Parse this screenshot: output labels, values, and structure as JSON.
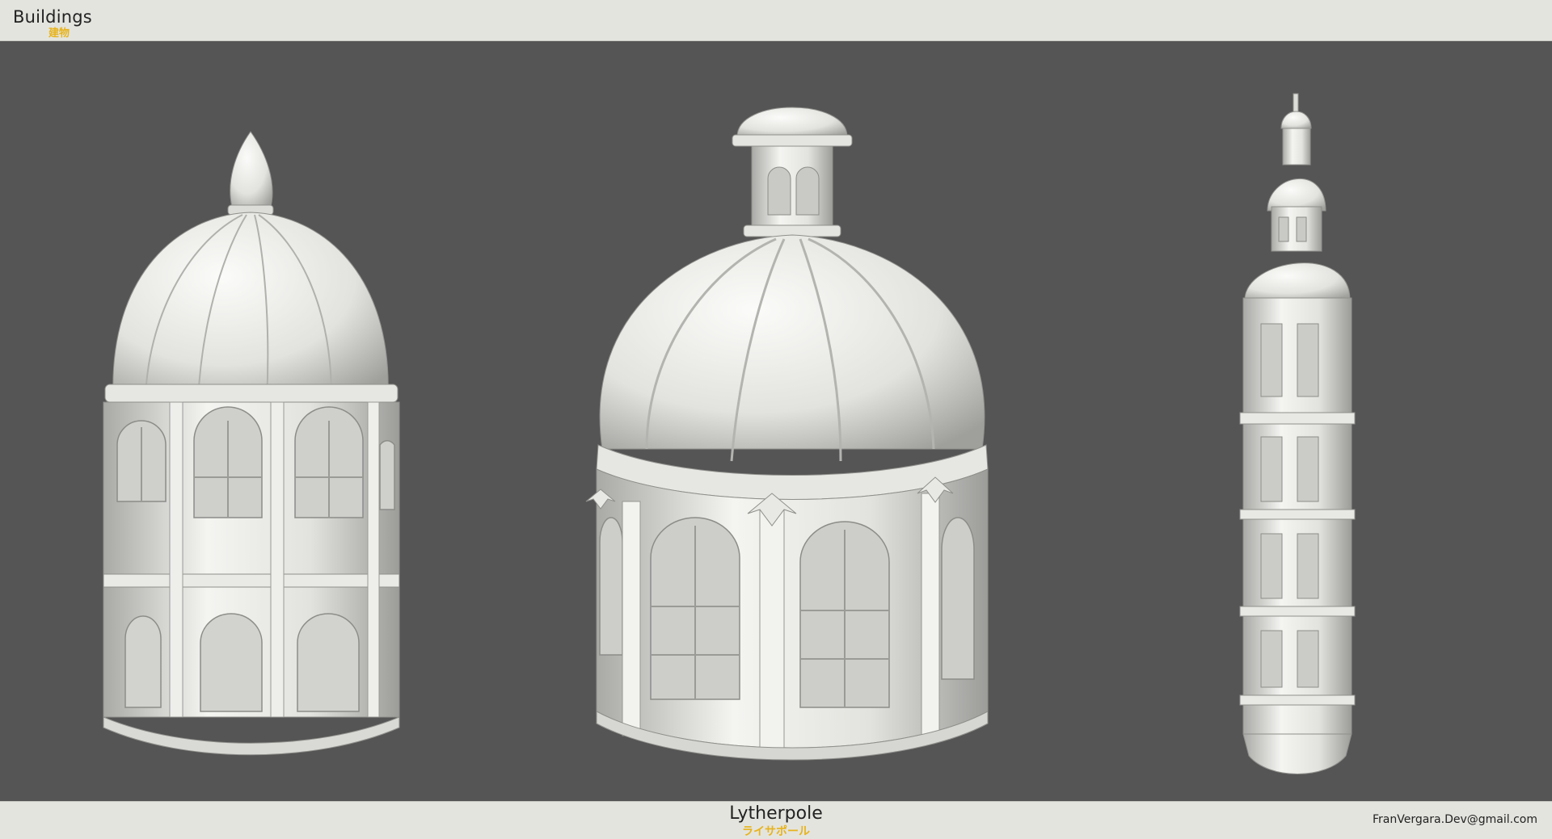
{
  "header": {
    "title": "Buildings",
    "subtitle": "建物"
  },
  "footer": {
    "brand": "Lytherpole",
    "brand_sub": "ライサポール",
    "email": "FranVergara.Dev@gmail.com"
  },
  "models": [
    {
      "name": "ribbed-dome-building"
    },
    {
      "name": "domed-pavilion-with-lantern"
    },
    {
      "name": "tall-tower"
    }
  ],
  "colors": {
    "background": "#555555",
    "bar": "#e4e4df",
    "accent": "#e7b41d",
    "model": "#eeeeeb"
  }
}
